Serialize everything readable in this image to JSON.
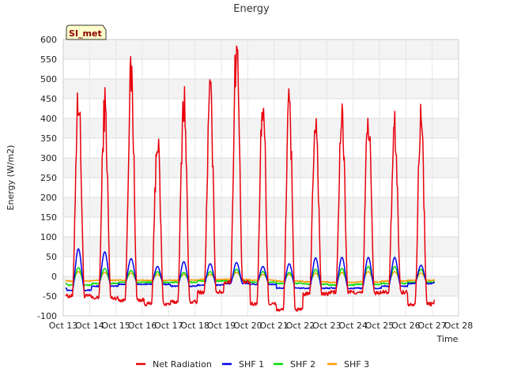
{
  "chart_data": {
    "type": "line",
    "title": "Energy",
    "xlabel": "Time",
    "ylabel": "Energy (W/m2)",
    "site_label": "SI_met",
    "xlim": [
      "2023-10-13",
      "2023-10-28"
    ],
    "ylim": [
      -100,
      600
    ],
    "x_ticks": [
      "Oct 13",
      "Oct 14",
      "Oct 15",
      "Oct 16",
      "Oct 17",
      "Oct 18",
      "Oct 19",
      "Oct 20",
      "Oct 21",
      "Oct 22",
      "Oct 23",
      "Oct 24",
      "Oct 25",
      "Oct 26",
      "Oct 27",
      "Oct 28"
    ],
    "y_ticks": [
      -100,
      -50,
      0,
      50,
      100,
      150,
      200,
      250,
      300,
      350,
      400,
      450,
      500,
      550,
      600
    ],
    "background_bands": true,
    "legend_position": "bottom",
    "series": [
      {
        "name": "Net Radiation",
        "color": "#e8000b",
        "daily_peaks": [
          455,
          428,
          500,
          345,
          448,
          458,
          580,
          445,
          425,
          398,
          402,
          400,
          372,
          400
        ],
        "night_values": [
          -50,
          -55,
          -60,
          -70,
          -65,
          -40,
          -15,
          -70,
          -85,
          -45,
          -40,
          -42,
          -40,
          -70,
          -55
        ],
        "start_value": -48,
        "end_value": -55
      },
      {
        "name": "SHF 1",
        "color": "#0000ee",
        "daily_peaks": [
          70,
          62,
          45,
          25,
          37,
          32,
          35,
          25,
          32,
          47,
          48,
          48,
          48,
          28
        ],
        "night_values": [
          -35,
          -25,
          -20,
          -20,
          -25,
          -22,
          -18,
          -20,
          -30,
          -30,
          -30,
          -30,
          -25,
          -18,
          -15
        ],
        "start_value": -30,
        "end_value": -18
      },
      {
        "name": "SHF 2",
        "color": "#00dd00",
        "daily_peaks": [
          22,
          20,
          15,
          12,
          10,
          12,
          18,
          12,
          10,
          18,
          20,
          25,
          25,
          18
        ],
        "night_values": [
          -22,
          -18,
          -15,
          -15,
          -15,
          -12,
          -12,
          -15,
          -18,
          -20,
          -22,
          -20,
          -18,
          -15,
          -12
        ],
        "start_value": -18,
        "end_value": -12
      },
      {
        "name": "SHF 3",
        "color": "#ff9900",
        "daily_peaks": [
          12,
          10,
          8,
          5,
          5,
          5,
          10,
          5,
          5,
          8,
          10,
          12,
          12,
          8
        ],
        "night_values": [
          -12,
          -10,
          -10,
          -10,
          -10,
          -8,
          -8,
          -10,
          -12,
          -14,
          -15,
          -14,
          -12,
          -10,
          -8
        ],
        "start_value": -10,
        "end_value": -8
      }
    ]
  }
}
